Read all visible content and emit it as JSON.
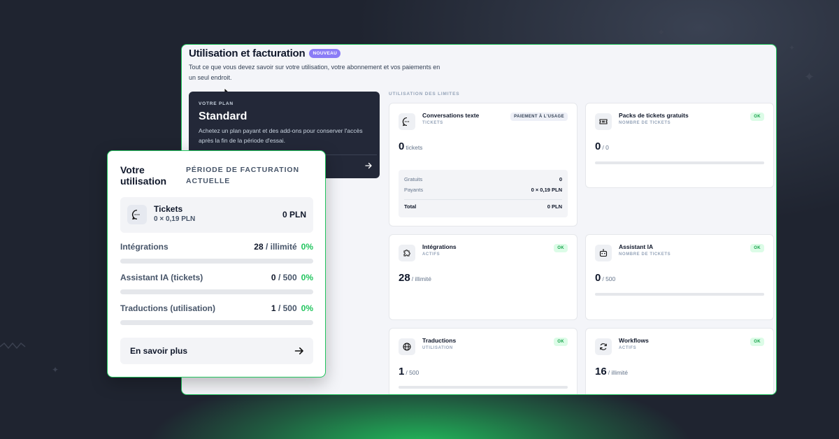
{
  "page": {
    "title": "Utilisation et facturation",
    "badge": "NOUVEAU",
    "subtitle": "Tout ce que vous devez savoir sur votre utilisation, votre abonnement et vos paiements en un seul endroit."
  },
  "plan": {
    "label": "VOTRE PLAN",
    "name": "Standard",
    "description": "Achetez un plan payant et des add-ons pour conserver l'accès après la fin de la période d'essai."
  },
  "limits": {
    "section_label": "UTILISATION DES LIMITES",
    "cards": [
      {
        "title": "Conversations texte",
        "subtitle": "TICKETS",
        "tag": "PAIEMENT À L'USAGE",
        "value": "0",
        "suffix": "tickets",
        "icon": "chat-icon"
      },
      {
        "title": "Packs de tickets gratuits",
        "subtitle": "NOMBRE DE TICKETS",
        "tag": "OK",
        "value": "0",
        "suffix": "/ 0",
        "icon": "ticket-icon"
      },
      {
        "title": "Intégrations",
        "subtitle": "ACTIFS",
        "tag": "OK",
        "value": "28",
        "suffix": "/ illimité",
        "icon": "puzzle-icon"
      },
      {
        "title": "Assistant IA",
        "subtitle": "NOMBRE DE TICKETS",
        "tag": "OK",
        "value": "0",
        "suffix": "/ 500",
        "icon": "robot-icon"
      },
      {
        "title": "Traductions",
        "subtitle": "UTILISATION",
        "tag": "OK",
        "value": "1",
        "suffix": "/ 500",
        "icon": "globe-icon"
      },
      {
        "title": "Workflows",
        "subtitle": "ACTIFS",
        "tag": "OK",
        "value": "16",
        "suffix": "/ illimité",
        "icon": "refresh-icon"
      }
    ],
    "breakdown": [
      {
        "label": "Gratuits",
        "value": "0"
      },
      {
        "label": "Payants",
        "value": "0 × 0,19 PLN"
      },
      {
        "label": "Total",
        "value": "0 PLN"
      }
    ]
  },
  "usage_panel": {
    "title": "Votre utilisation",
    "period": "PÉRIODE DE FACTURATION ACTUELLE",
    "tickets": {
      "label": "Tickets",
      "detail": "0 × 0,19 PLN",
      "price": "0 PLN"
    },
    "rows": [
      {
        "label": "Intégrations",
        "used": "28",
        "limit": "/ illimité",
        "percent": "0%",
        "progress": 0
      },
      {
        "label": "Assistant IA (tickets)",
        "used": "0",
        "limit": "/ 500",
        "percent": "0%",
        "progress": 0
      },
      {
        "label": "Traductions (utilisation)",
        "used": "1",
        "limit": "/ 500",
        "percent": "0%",
        "progress": 0
      }
    ],
    "learn_more": "En savoir plus"
  }
}
